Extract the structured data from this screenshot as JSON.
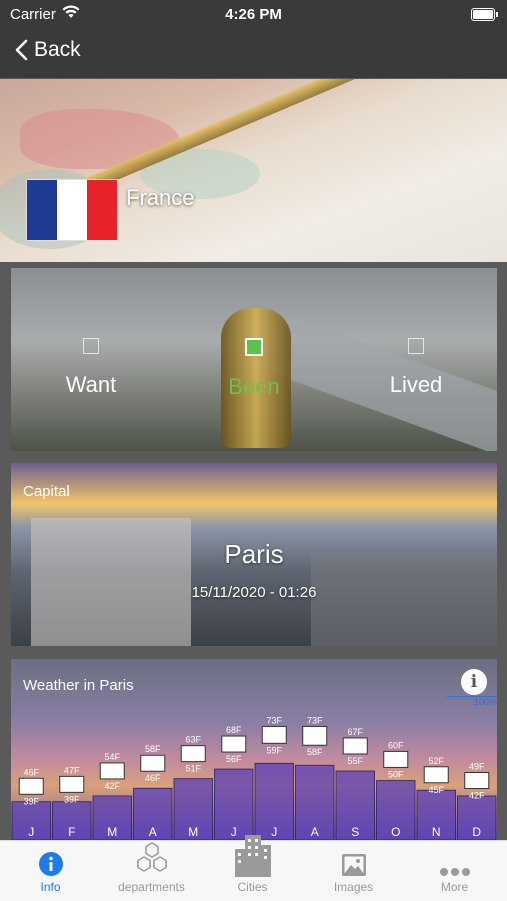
{
  "status_bar": {
    "carrier": "Carrier",
    "time": "4:26 PM"
  },
  "nav": {
    "back_label": "Back"
  },
  "country": {
    "name": "France",
    "flag_colors": [
      "#1f3a93",
      "#ffffff",
      "#e8222b"
    ]
  },
  "visit_status": {
    "options": [
      {
        "label": "Want",
        "checked": false
      },
      {
        "label": "Been",
        "checked": true
      },
      {
        "label": "Lived",
        "checked": false
      }
    ]
  },
  "capital": {
    "heading": "Capital",
    "city": "Paris",
    "datetime": "15/11/2020 - 01:26"
  },
  "weather": {
    "title": "Weather in Paris",
    "info_percent": "100%"
  },
  "chart_data": {
    "type": "bar",
    "categories": [
      "J",
      "F",
      "M",
      "A",
      "M",
      "J",
      "J",
      "A",
      "S",
      "O",
      "N",
      "D"
    ],
    "series": [
      {
        "values": [
          46,
          47,
          54,
          58,
          63,
          68,
          73,
          73,
          67,
          60,
          52,
          49
        ]
      },
      {
        "values": [
          39,
          39,
          42,
          46,
          51,
          56,
          59,
          58,
          55,
          50,
          45,
          42
        ]
      }
    ],
    "high_labels": [
      "46F",
      "47F",
      "54F",
      "58F",
      "63F",
      "68F",
      "73F",
      "73F",
      "67F",
      "60F",
      "52F",
      "49F"
    ],
    "low_labels": [
      "39F",
      "39F",
      "42F",
      "46F",
      "51F",
      "56F",
      "59F",
      "58F",
      "55F",
      "50F",
      "45F",
      "42F"
    ],
    "ylim": [
      30,
      80
    ]
  },
  "tabbar": {
    "tabs": [
      {
        "label": "Info",
        "icon": "info-icon",
        "active": true
      },
      {
        "label": "departments",
        "icon": "hexagons-icon",
        "active": false
      },
      {
        "label": "Cities",
        "icon": "buildings-icon",
        "active": false
      },
      {
        "label": "Images",
        "icon": "image-icon",
        "active": false
      },
      {
        "label": "More",
        "icon": "more-icon",
        "active": false
      }
    ]
  },
  "colors": {
    "accent": "#1e7be8",
    "checked": "#6fbf4e",
    "bar_fill": "#5a3fb8"
  }
}
